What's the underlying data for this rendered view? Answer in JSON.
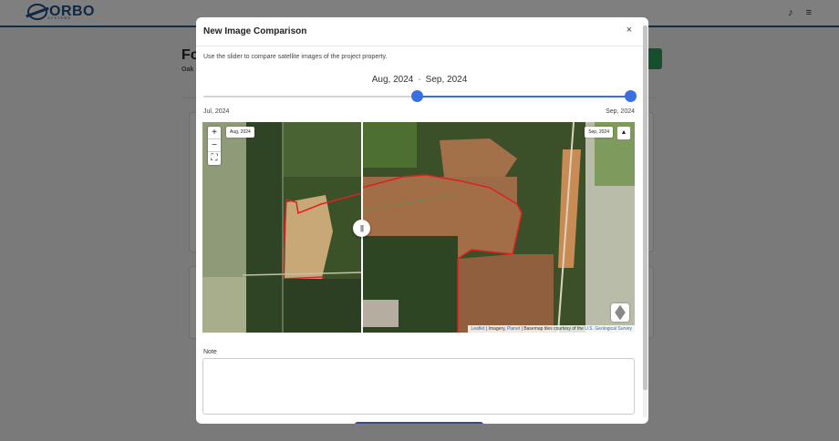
{
  "app": {
    "logo_text": "ORBO",
    "logo_sub": "SYSTEMS",
    "page_title": "Fo",
    "page_sub": "Oak"
  },
  "modal": {
    "title": "New Image Comparison",
    "close_symbol": "×",
    "description": "Use the slider to compare satellite images of the project property.",
    "range_start": "Aug, 2024",
    "range_sep": "-",
    "range_end": "Sep, 2024",
    "slider": {
      "min_label": "Jul, 2024",
      "max_label": "Sep, 2024",
      "low_fraction": 0.5,
      "high_fraction": 1.0
    },
    "map": {
      "left_date": "Aug, 2024",
      "right_date": "Sep, 2024",
      "zoom_in": "+",
      "zoom_out": "−",
      "fullscreen": "⛶",
      "north": "▲",
      "divider_grip": "|||",
      "attribution": {
        "leaflet": "Leaflet",
        "imagery": "| Imagery,",
        "planet": "Planet",
        "basemap": "| Basemap tiles courtesy of the",
        "us": "U.S.",
        "geo": "Geological Survey"
      }
    },
    "note_label": "Note",
    "note_value": ""
  },
  "icons": {
    "bell": "🔔",
    "menu": "≡"
  },
  "colors": {
    "accent": "#3a6fe0",
    "boundary": "#e02020",
    "brand": "#1e4f86"
  }
}
